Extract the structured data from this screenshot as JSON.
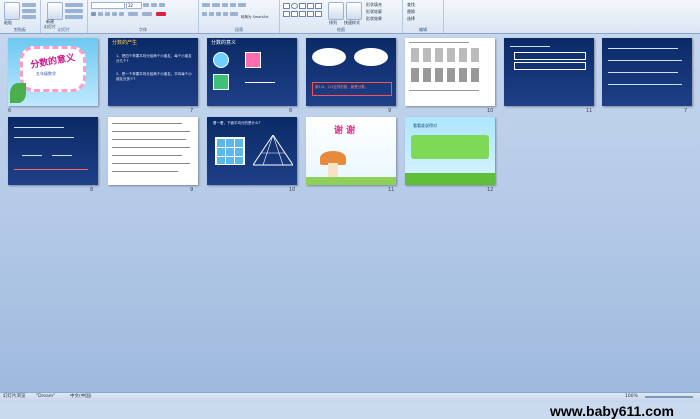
{
  "ribbon": {
    "groups": [
      {
        "label": "剪贴板"
      },
      {
        "label": "幻灯片"
      },
      {
        "label": "字体"
      },
      {
        "label": "段落"
      },
      {
        "label": "绘图"
      },
      {
        "label": "编辑"
      }
    ],
    "paste_label": "粘贴",
    "new_slide_label": "新建",
    "new_slide_sub": "幻灯片",
    "convert_smartart": "转换为 SmartArt",
    "arrange_label": "排列",
    "quick_styles_label": "快速样式",
    "shape_fill": "形状填充",
    "shape_outline": "形状轮廓",
    "shape_effects": "形状效果",
    "find_label": "查找",
    "replace_label": "替换",
    "select_label": "选择",
    "font_size": "32"
  },
  "slides": [
    {
      "num": "6",
      "title": "分数的意义",
      "subtitle": "五年级数学"
    },
    {
      "num": "7",
      "title": "分数的产生",
      "line1": "1、把四个苹果平均分给两个小朋友，每个小朋友分几个?",
      "line2": "2、把一个苹果平均分给两个小朋友，平均每个小朋友分多少?"
    },
    {
      "num": "8",
      "title": "分数的意义"
    },
    {
      "num": "9",
      "note": "像1/4、2/3这样的数，都是分数。"
    },
    {
      "num": "10"
    },
    {
      "num": "11"
    },
    {
      "num": "7"
    },
    {
      "num": "8"
    },
    {
      "num": "9"
    },
    {
      "num": "10",
      "question": "看一看，下面平均分的是什么？"
    },
    {
      "num": "11",
      "title": "谢 谢"
    },
    {
      "num": "12",
      "text": "看看谁说得对"
    }
  ],
  "watermark": "www.baby611.com",
  "status": {
    "view": "幻灯片浏览",
    "theme": "\"Dream\"",
    "language": "中文(中国)",
    "zoom": "100%"
  }
}
